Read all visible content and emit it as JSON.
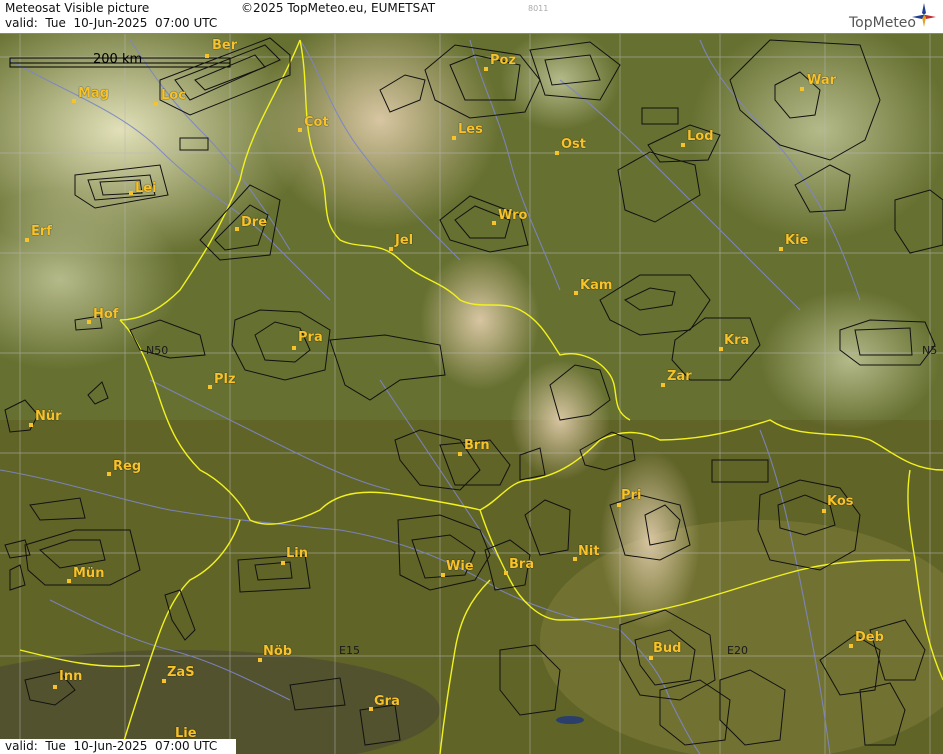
{
  "header": {
    "title": "Meteosat Visible picture",
    "valid": "valid:  Tue  10-Jun-2025  07:00 UTC",
    "copyright": "©2025 TopMeteo.eu, EUMETSAT",
    "code": "8011",
    "logo": "TopMeteo",
    "logo_icon": "compass-star-icon"
  },
  "footer": {
    "valid": "valid:  Tue  10-Jun-2025  07:00 UTC"
  },
  "scale": {
    "label": "200 km"
  },
  "grid_labels": {
    "n50_left": "N50",
    "n50_right": "N5",
    "e15": "E15",
    "e20": "E20"
  },
  "colors": {
    "border": "#f2f21e",
    "river": "#7d86c6",
    "label": "#f7c22a",
    "grid": "#b8b8b8"
  },
  "cities": [
    {
      "id": "ber",
      "label": "Ber"
    },
    {
      "id": "mag",
      "label": "Mag"
    },
    {
      "id": "loc",
      "label": "Loc"
    },
    {
      "id": "cot",
      "label": "Cot"
    },
    {
      "id": "poz",
      "label": "Poz"
    },
    {
      "id": "war",
      "label": "War"
    },
    {
      "id": "les",
      "label": "Les"
    },
    {
      "id": "ost",
      "label": "Ost"
    },
    {
      "id": "lod",
      "label": "Lod"
    },
    {
      "id": "lei",
      "label": "Lei"
    },
    {
      "id": "dre",
      "label": "Dre"
    },
    {
      "id": "wro",
      "label": "Wro"
    },
    {
      "id": "erf",
      "label": "Erf"
    },
    {
      "id": "jel",
      "label": "Jel"
    },
    {
      "id": "kie",
      "label": "Kie"
    },
    {
      "id": "kam",
      "label": "Kam"
    },
    {
      "id": "hof",
      "label": "Hof"
    },
    {
      "id": "pra",
      "label": "Pra"
    },
    {
      "id": "kra",
      "label": "Kra"
    },
    {
      "id": "plz",
      "label": "Plz"
    },
    {
      "id": "zar",
      "label": "Zar"
    },
    {
      "id": "nur",
      "label": "Nür"
    },
    {
      "id": "brn",
      "label": "Brn"
    },
    {
      "id": "reg",
      "label": "Reg"
    },
    {
      "id": "pri",
      "label": "Pri"
    },
    {
      "id": "kos",
      "label": "Kos"
    },
    {
      "id": "lin",
      "label": "Lin"
    },
    {
      "id": "wie",
      "label": "Wie"
    },
    {
      "id": "bra",
      "label": "Bra"
    },
    {
      "id": "nit",
      "label": "Nit"
    },
    {
      "id": "mun",
      "label": "Mün"
    },
    {
      "id": "nob",
      "label": "Nöb"
    },
    {
      "id": "bud",
      "label": "Bud"
    },
    {
      "id": "deb",
      "label": "Deb"
    },
    {
      "id": "inn",
      "label": "Inn"
    },
    {
      "id": "zas",
      "label": "ZaS"
    },
    {
      "id": "gra",
      "label": "Gra"
    },
    {
      "id": "lie",
      "label": "Lie"
    }
  ]
}
